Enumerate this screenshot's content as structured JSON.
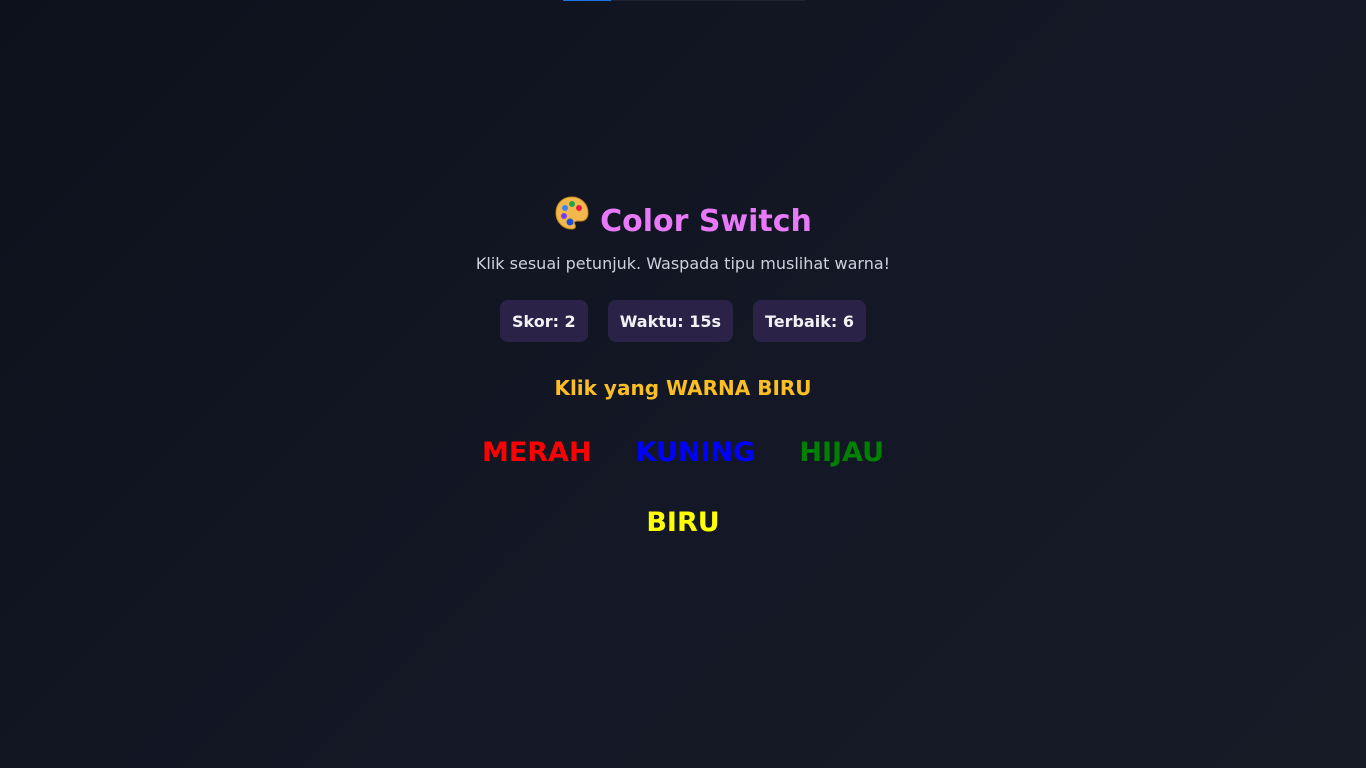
{
  "progress": {
    "fraction": 0.2,
    "fill_color": "#1e73e8"
  },
  "header": {
    "icon": "palette-icon",
    "title": "Color Switch",
    "subtitle": "Klik sesuai petunjuk. Waspada tipu muslihat warna!"
  },
  "stats": {
    "score": "Skor: 2",
    "time": "Waktu: 15s",
    "best": "Terbaik: 6"
  },
  "instruction": "Klik yang WARNA BIRU",
  "options": [
    {
      "label": "MERAH",
      "color": "#ff0000"
    },
    {
      "label": "KUNING",
      "color": "#0000ff"
    },
    {
      "label": "HIJAU",
      "color": "#008000"
    },
    {
      "label": "BIRU",
      "color": "#ffff00"
    }
  ],
  "colors": {
    "title": "#e879f9",
    "instruction": "#fbbf24",
    "stat_bg": "#2a2347",
    "background": "#0d111b"
  }
}
